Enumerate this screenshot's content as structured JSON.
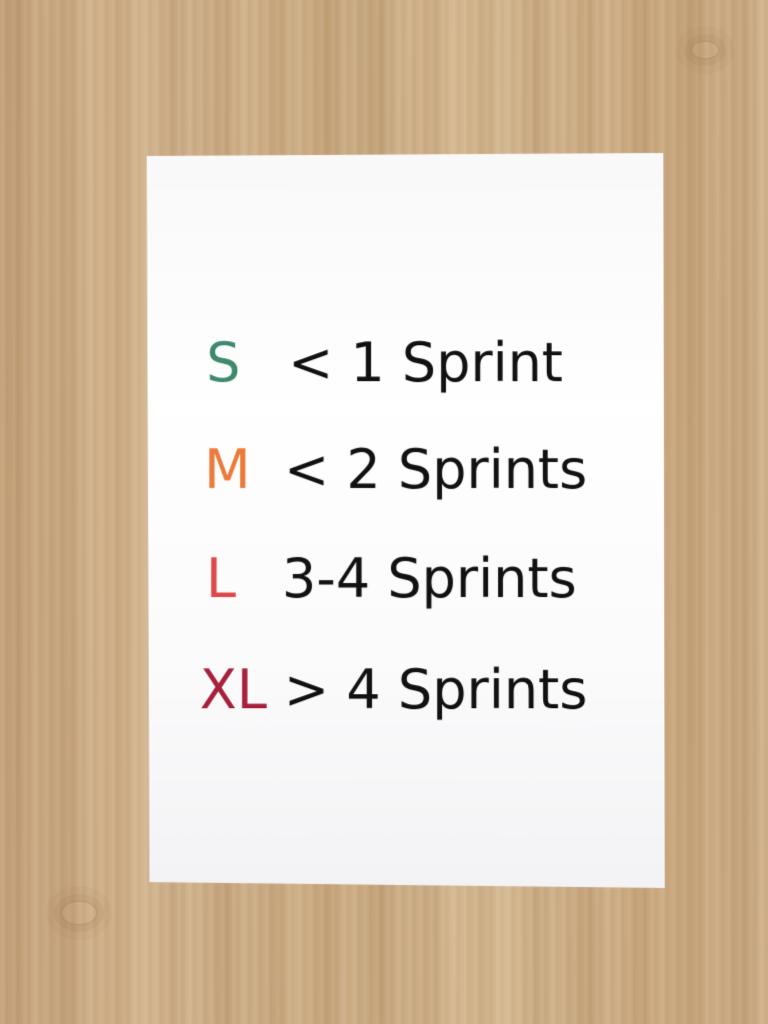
{
  "sheet": {
    "rows": [
      {
        "size": "S",
        "description": "< 1 Sprint",
        "color": "#3f8a6d"
      },
      {
        "size": "M",
        "description": "< 2 Sprints",
        "color": "#ec7a3a"
      },
      {
        "size": "L",
        "description": "3-4 Sprints",
        "color": "#e04848"
      },
      {
        "size": "XL",
        "description": "> 4 Sprints",
        "color": "#a8213c"
      }
    ]
  }
}
